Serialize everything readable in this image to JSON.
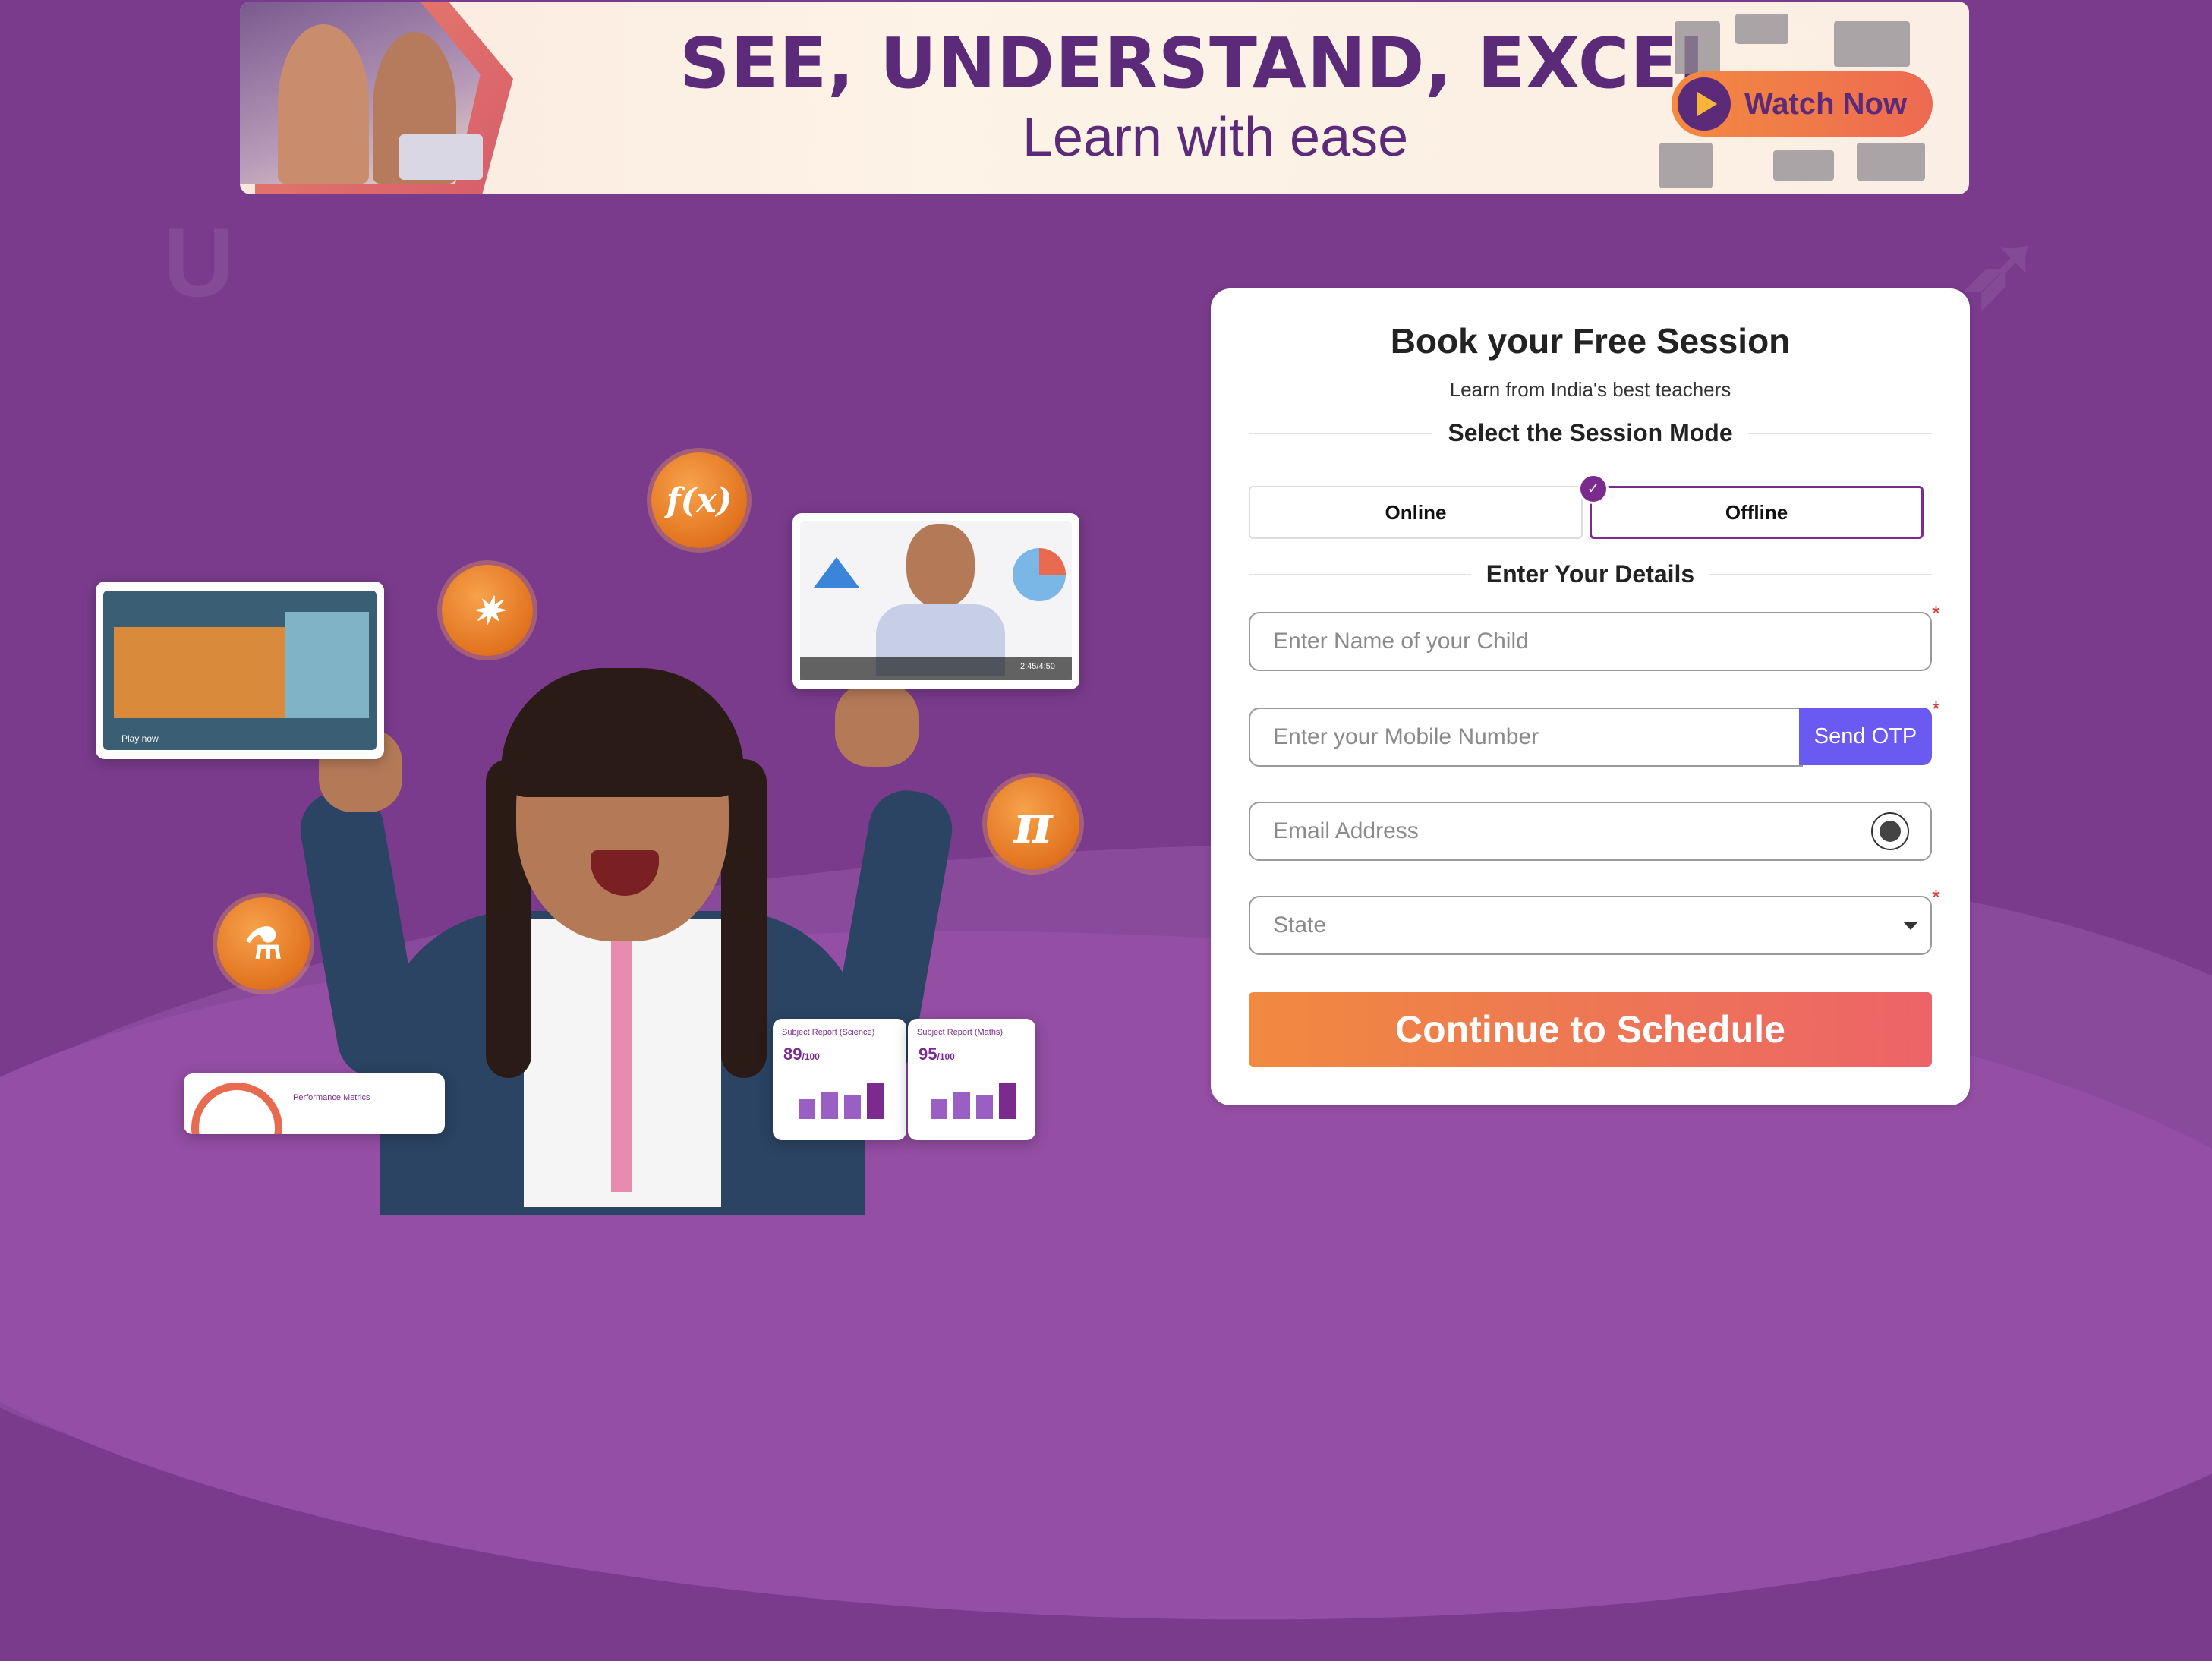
{
  "banner": {
    "headline": "SEE, UNDERSTAND, EXCEL.",
    "subheadline": "Learn with ease",
    "watch_label": "Watch Now",
    "close_icon": "×"
  },
  "hero": {
    "orb_fx": "f(x)",
    "orb_pi": "π",
    "video_time": "2:45/4:50",
    "play_now": "Play now",
    "report_science": "Subject Report (Science)",
    "report_science_score": "89",
    "report_maths": "Subject Report (Maths)",
    "report_maths_score": "95",
    "score_suffix": "/100",
    "metrics_label": "Performance Metrics"
  },
  "form": {
    "title": "Book your Free Session",
    "subtitle": "Learn from India's best teachers",
    "mode_heading": "Select the Session Mode",
    "modes": [
      {
        "label": "Online",
        "selected": false
      },
      {
        "label": "Offline",
        "selected": true
      }
    ],
    "details_heading": "Enter Your Details",
    "name_placeholder": "Enter Name of your Child",
    "mobile_placeholder": "Enter your Mobile Number",
    "otp_label": "Send OTP",
    "email_placeholder": "Email Address",
    "state_placeholder": "State",
    "required_mark": "*",
    "cta_label": "Continue to Schedule"
  },
  "colors": {
    "background": "#7a3b8c",
    "brand_purple": "#7b2a8e",
    "otp_button": "#6a5af2",
    "cta_start": "#f08a3f",
    "cta_end": "#ec6468"
  }
}
